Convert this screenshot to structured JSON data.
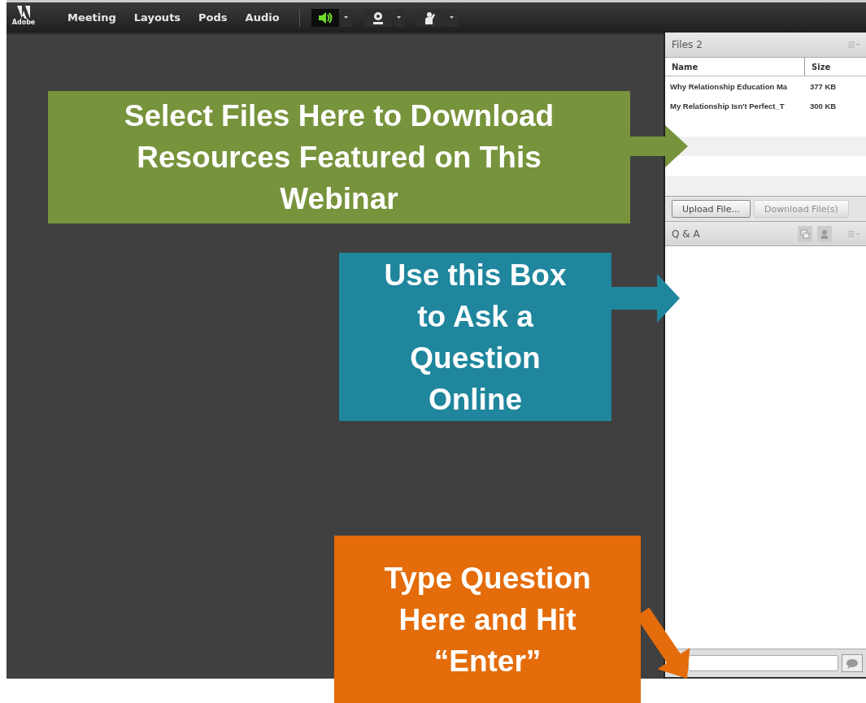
{
  "menu_bar": {
    "logo": "Adobe",
    "menus": [
      "Meeting",
      "Layouts",
      "Pods",
      "Audio"
    ],
    "tools": [
      {
        "kind": "speaker",
        "active": true
      },
      {
        "kind": "camera",
        "active": false
      },
      {
        "kind": "raise-hand",
        "active": false
      }
    ]
  },
  "files_pod": {
    "title": "Files 2",
    "columns": [
      "Name",
      "Size"
    ],
    "rows": [
      {
        "name": "Why Relationship Education Ma",
        "size": "377 KB"
      },
      {
        "name": "My Relationship Isn't Perfect_T",
        "size": "300 KB"
      }
    ],
    "buttons": [
      {
        "label": "Upload File...",
        "disabled": false
      },
      {
        "label": "Download File(s)",
        "disabled": true
      }
    ]
  },
  "qa_pod": {
    "title": "Q & A"
  },
  "callouts": [
    {
      "text": "Select Files Here to Download Resources Featured on This Webinar",
      "color": "#77933c",
      "kind": "right"
    },
    {
      "text": "Use this Box to Ask a Question Online",
      "color": "#1f869d",
      "kind": "right"
    },
    {
      "text": "Type Question Here and Hit “Enter”",
      "color": "#e46c0a",
      "kind": "diagonal"
    }
  ]
}
